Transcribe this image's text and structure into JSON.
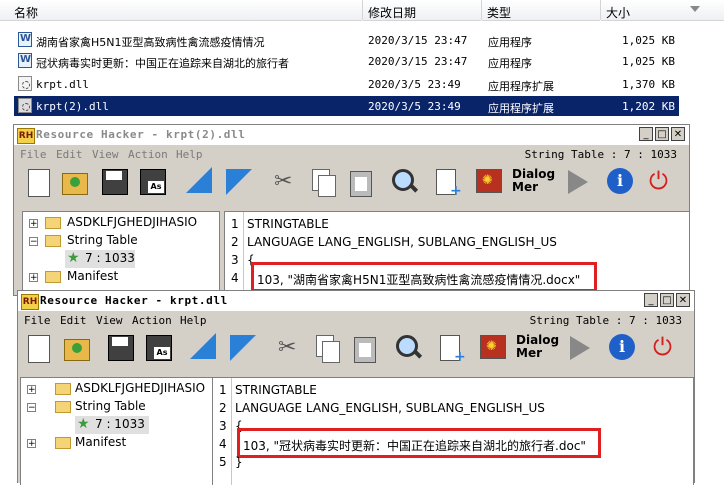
{
  "explorer": {
    "columns": [
      "名称",
      "修改日期",
      "类型",
      "大小"
    ],
    "files": [
      {
        "icon": "exe-icon",
        "name": "湖南省家禽H5N1亚型高致病性禽流感疫情情况",
        "date": "2020/3/15 23:47",
        "type": "应用程序",
        "size": "1,025 KB",
        "selected": false
      },
      {
        "icon": "exe-icon",
        "name": "冠状病毒实时更新：中国正在追踪来自湖北的旅行者",
        "date": "2020/3/15 23:47",
        "type": "应用程序",
        "size": "1,025 KB",
        "selected": false
      },
      {
        "icon": "dll-icon",
        "name": "krpt.dll",
        "date": "2020/3/5 23:49",
        "type": "应用程序扩展",
        "size": "1,370 KB",
        "selected": false
      },
      {
        "icon": "dll-icon",
        "name": "krpt(2).dll",
        "date": "2020/3/5 23:49",
        "type": "应用程序扩展",
        "size": "1,202 KB",
        "selected": true
      }
    ]
  },
  "rh_back": {
    "logo": "RH",
    "title": "Resource Hacker - krpt(2).dll",
    "menu": [
      "File",
      "Edit",
      "View",
      "Action",
      "Help"
    ],
    "status": "String Table : 7 : 1033",
    "tree": [
      "ASDKLFJGHEDJIHASIO",
      "String Table",
      "7 : 1033",
      "Manifest"
    ],
    "line_numbers": [
      "1",
      "2",
      "3",
      "4"
    ],
    "code": [
      "STRINGTABLE",
      "LANGUAGE LANG_ENGLISH, SUBLANG_ENGLISH_US",
      "{",
      "103,   \"湖南省家禽H5N1亚型高致病性禽流感疫情情况.docx\""
    ]
  },
  "rh_front": {
    "logo": "RH",
    "title": "Resource Hacker - krpt.dll",
    "menu": [
      "File",
      "Edit",
      "View",
      "Action",
      "Help"
    ],
    "status": "String Table : 7 : 1033",
    "tree": [
      "ASDKLFJGHEDJIHASIO",
      "String Table",
      "7 : 1033",
      "Manifest"
    ],
    "line_numbers": [
      "1",
      "2",
      "3",
      "4",
      "5"
    ],
    "code": [
      "STRINGTABLE",
      "LANGUAGE LANG_ENGLISH, SUBLANG_ENGLISH_US",
      "{",
      "103,   \"冠状病毒实时更新：中国正在追踪来自湖北的旅行者.doc\"",
      "}"
    ]
  },
  "toolbar": {
    "dialog_label_1": "Dialog",
    "dialog_label_2": "Mer",
    "icons": [
      "new-icon",
      "open-icon",
      "save-icon",
      "save-as-icon",
      "compile-icon",
      "run-icon",
      "cut-icon",
      "copy-icon",
      "paste-icon",
      "find-icon",
      "add-resource-icon",
      "add-image-icon",
      "dialog-merge-icon",
      "play-icon",
      "info-icon",
      "power-icon"
    ]
  },
  "colors": {
    "selection": "#0a246a",
    "highlight_box": "#e02020",
    "window_bg": "#d4d0c8"
  }
}
